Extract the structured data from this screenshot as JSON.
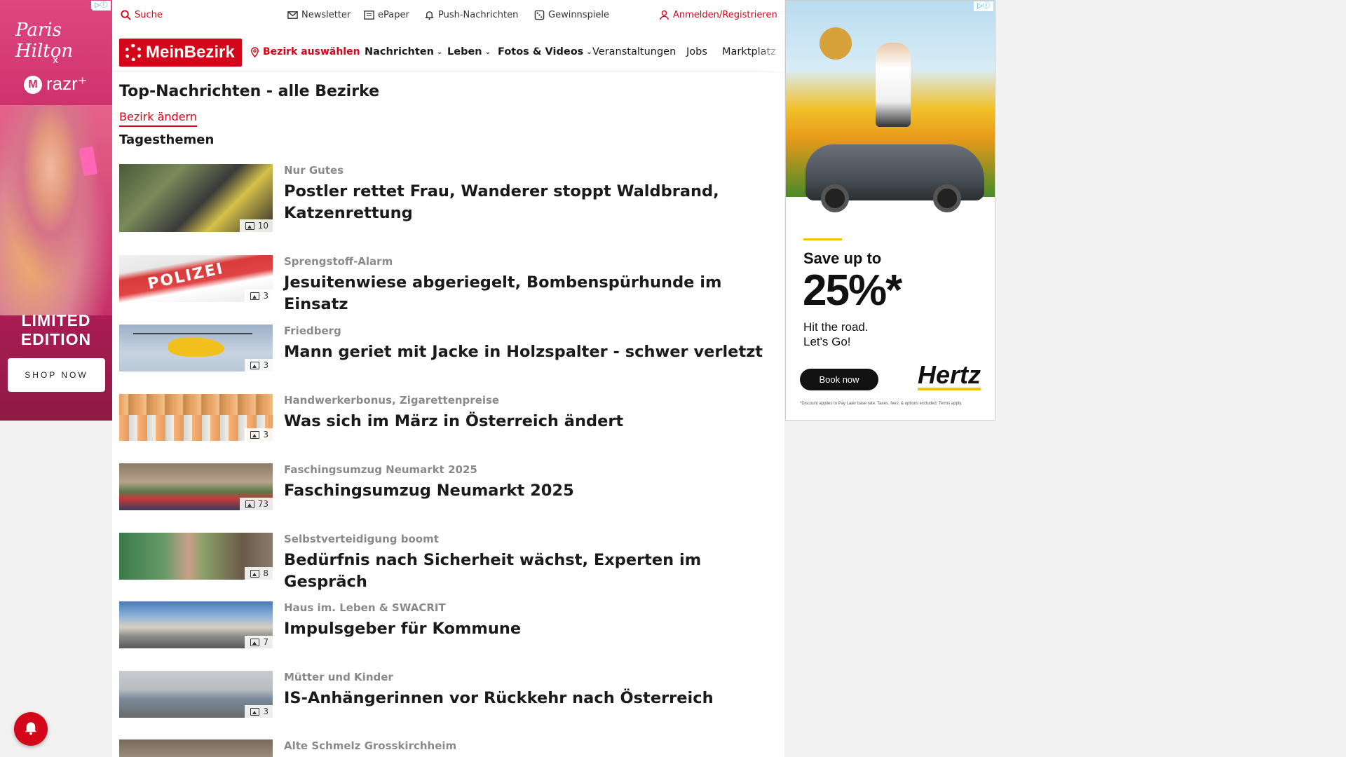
{
  "ad_left": {
    "adchoice": "▷ⓘ",
    "brand": "Paris Hilton",
    "x": "x",
    "razr": "razr⁺",
    "moto": "M",
    "limited": "LIMITED EDITION",
    "shop": "SHOP NOW"
  },
  "topbar": {
    "search": "Suche",
    "newsletter": "Newsletter",
    "epaper": "ePaper",
    "push": "Push-Nachrichten",
    "games": "Gewinnspiele",
    "login": "Anmelden/Registrieren"
  },
  "nav": {
    "logo": "MeinBezirk",
    "bezirk": "Bezirk auswählen",
    "items": [
      "Nachrichten",
      "Leben",
      "Fotos & Videos",
      "Veranstaltungen",
      "Jobs",
      "Marktplatz"
    ]
  },
  "page": {
    "title": "Top-Nachrichten - alle Bezirke",
    "change": "Bezirk ändern",
    "section": "Tagesthemen"
  },
  "articles": [
    {
      "kicker": "Nur Gutes",
      "headline": "Postler rettet Frau, Wanderer stoppt Waldbrand, Katzenrettung",
      "count": "10"
    },
    {
      "kicker": "Sprengstoff-Alarm",
      "headline": "Jesuitenwiese abgeriegelt, Bombenspürhunde im Einsatz",
      "count": "3",
      "thumb_text": "POLIZEI"
    },
    {
      "kicker": "Friedberg",
      "headline": "Mann geriet mit Jacke in Holzspalter - schwer verletzt",
      "count": "3"
    },
    {
      "kicker": "Handwerkerbonus, Zigarettenpreise",
      "headline": "Was sich im März in Österreich ändert",
      "count": "3"
    },
    {
      "kicker": "Faschingsumzug Neumarkt 2025",
      "headline": "Faschingsumzug Neumarkt 2025",
      "count": "73"
    },
    {
      "kicker": "Selbstverteidigung boomt",
      "headline": "Bedürfnis nach Sicherheit wächst, Experten im Gespräch",
      "count": "8"
    },
    {
      "kicker": "Haus im. Leben & SWACRIT",
      "headline": "Impulsgeber für Kommune",
      "count": "7"
    },
    {
      "kicker": "Mütter und Kinder",
      "headline": "IS-Anhängerinnen vor Rückkehr nach Österreich",
      "count": "3"
    },
    {
      "kicker": "Alte Schmelz Grosskirchheim",
      "headline": "",
      "count": ""
    }
  ],
  "ad_right": {
    "adchoice": "▷ⓘ",
    "save": "Save up to",
    "pct": "25%*",
    "road": "Hit the road.\nLet's Go!",
    "book": "Book now",
    "brand": "Hertz",
    "fine": "*Discount applies to Pay Later base rate. Taxes, fees, & options excluded. Terms apply."
  },
  "colors": {
    "brand_red": "#d2081a"
  }
}
